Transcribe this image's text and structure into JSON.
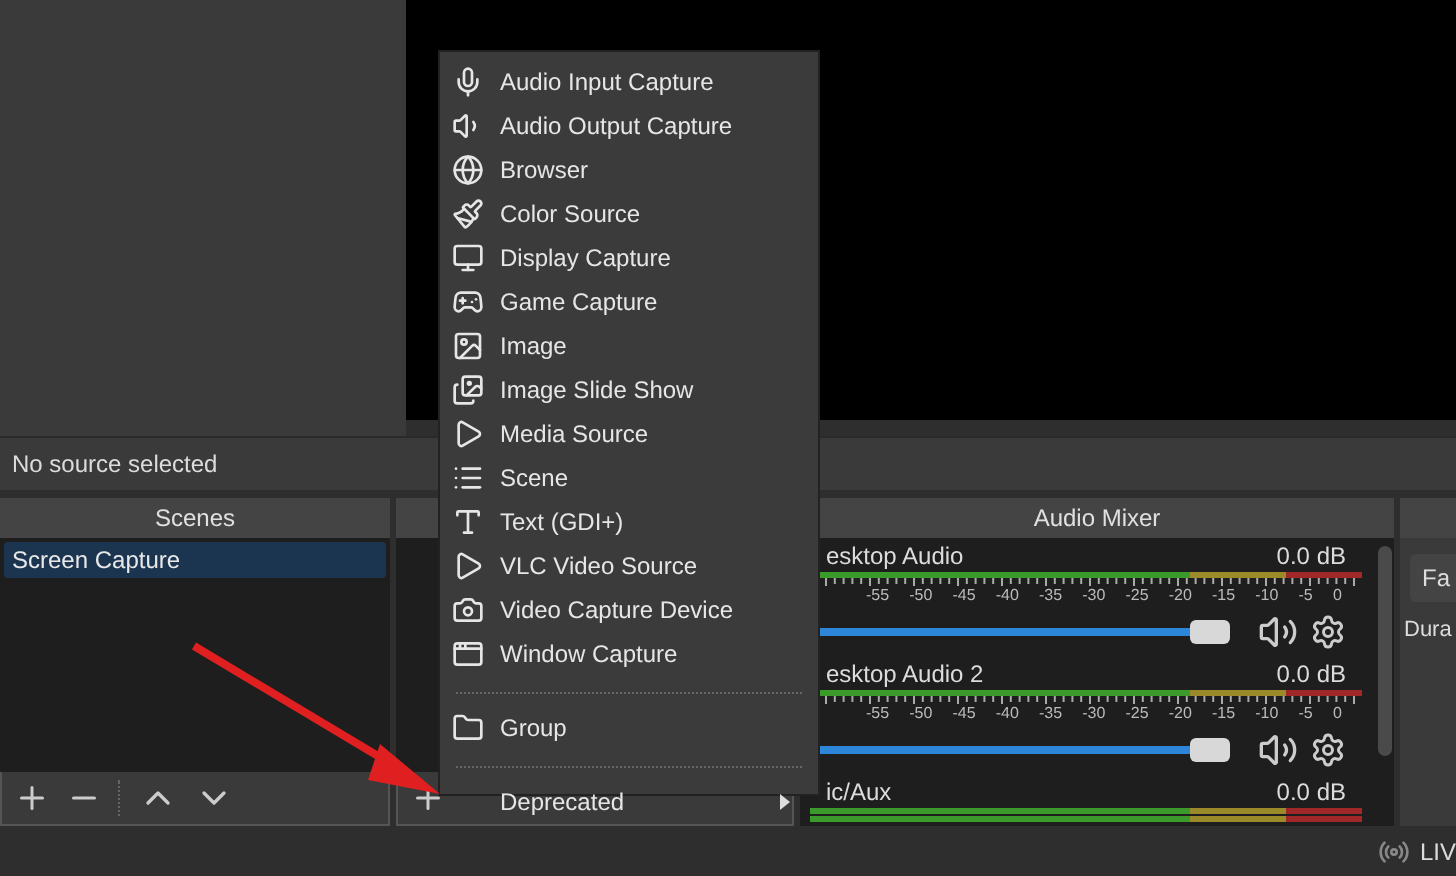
{
  "context_bar": {
    "text": "No source selected"
  },
  "scenes": {
    "title": "Scenes",
    "items": [
      {
        "label": "Screen Capture",
        "selected": true
      }
    ]
  },
  "audio_mixer": {
    "title": "Audio Mixer",
    "channels": [
      {
        "name": "esktop Audio",
        "reading": "0.0 dB",
        "level": 0.96,
        "scale": [
          "-55",
          "-50",
          "-45",
          "-40",
          "-35",
          "-30",
          "-25",
          "-20",
          "-15",
          "-10",
          "-5",
          "0"
        ]
      },
      {
        "name": "esktop Audio 2",
        "reading": "0.0 dB",
        "level": 0.96,
        "scale": [
          "-55",
          "-50",
          "-45",
          "-40",
          "-35",
          "-30",
          "-25",
          "-20",
          "-15",
          "-10",
          "-5",
          "0"
        ]
      },
      {
        "name": "ic/Aux",
        "reading": "0.0 dB"
      }
    ]
  },
  "controls": {
    "button": "Fa",
    "label": "Dura"
  },
  "status_bar": {
    "live": "LIV"
  },
  "source_menu": {
    "items": [
      {
        "kind": "item",
        "label": "Audio Input Capture"
      },
      {
        "kind": "item",
        "label": "Audio Output Capture"
      },
      {
        "kind": "item",
        "label": "Browser"
      },
      {
        "kind": "item",
        "label": "Color Source"
      },
      {
        "kind": "item",
        "label": "Display Capture"
      },
      {
        "kind": "item",
        "label": "Game Capture"
      },
      {
        "kind": "item",
        "label": "Image"
      },
      {
        "kind": "item",
        "label": "Image Slide Show"
      },
      {
        "kind": "item",
        "label": "Media Source"
      },
      {
        "kind": "item",
        "label": "Scene"
      },
      {
        "kind": "item",
        "label": "Text (GDI+)"
      },
      {
        "kind": "item",
        "label": "VLC Video Source"
      },
      {
        "kind": "item",
        "label": "Video Capture Device"
      },
      {
        "kind": "item",
        "label": "Window Capture"
      },
      {
        "kind": "separator"
      },
      {
        "kind": "item",
        "label": "Group"
      },
      {
        "kind": "separator"
      },
      {
        "kind": "submenu",
        "label": "Deprecated"
      }
    ]
  }
}
